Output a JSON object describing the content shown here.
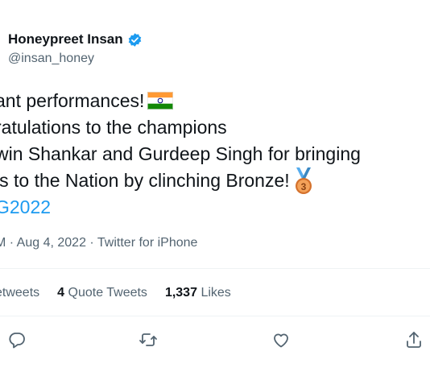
{
  "user": {
    "name": "Honeypreet Insan",
    "handle": "@insan_honey"
  },
  "tweet": {
    "lines": [
      "ant performances!",
      "ratulations to the champions",
      "win Shankar and Gurdeep Singh for bringing",
      "ls to the Nation by clinching Bronze!"
    ],
    "hashtag": "G2022",
    "flag_icon": "india-flag",
    "medal_icon": "bronze-medal",
    "medal_label": "3"
  },
  "meta": {
    "time_fragment": "M",
    "date": "Aug 4, 2022",
    "source": "Twitter for iPhone"
  },
  "stats": {
    "retweets_label": "etweets",
    "quote_count": "4",
    "quote_label": "Quote Tweets",
    "likes_count": "1,337",
    "likes_label": "Likes"
  },
  "colors": {
    "accent": "#1d9bf0",
    "muted": "#536471",
    "divider": "#eff3f4"
  }
}
